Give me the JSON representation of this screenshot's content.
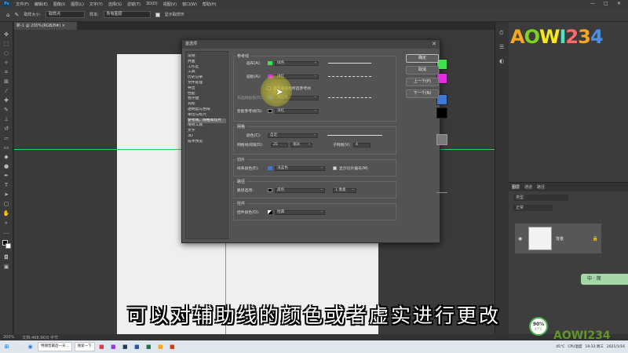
{
  "menubar": {
    "app_icon": "Ps",
    "items": [
      "文件(F)",
      "编辑(E)",
      "图像(I)",
      "图层(L)",
      "文字(Y)",
      "选择(S)",
      "滤镜(T)",
      "3D(D)",
      "视图(V)",
      "窗口(W)",
      "帮助(H)"
    ],
    "window_controls": [
      "—",
      "□",
      "✕"
    ]
  },
  "optionsbar": {
    "sample_size_label": "取样大小:",
    "sample_size_value": "取样点",
    "sample_label": "样本:",
    "sample_value": "所有图层",
    "show_ring_label": "显示取样环"
  },
  "document_tab": {
    "title": "新-1 @ 200%(RGB/8#) ×"
  },
  "dialog": {
    "title": "首选项",
    "close": "✕",
    "categories": [
      "常规",
      "界面",
      "工作区",
      "工具",
      "历史记录",
      "文件处理",
      "导出",
      "性能",
      "暂存盘",
      "光标",
      "透明度与色域",
      "单位与标尺",
      "参考线、网格和切片",
      "增效工具",
      "文字",
      "3D",
      "技术预览"
    ],
    "selected_index": 12,
    "guides": {
      "section_title": "参考线",
      "canvas_label": "画布(A):",
      "canvas_color": "绿色",
      "artboard_label": "画板(A):",
      "artboard_color": "洋红",
      "show_nonselected_label": "显示非画板所选参考线",
      "nonselected_label": "非选择画板(D):",
      "nonselected_color": "浅蓝色",
      "smart_label": "智能参考线(S):",
      "smart_color": "洋红"
    },
    "grid": {
      "section_title": "网格",
      "color_label": "颜色(C):",
      "color_value": "自定",
      "gridline_label": "网格线间隔(D):",
      "gridline_value": "25",
      "unit_value": "毫米",
      "subdiv_label": "子网格(V):",
      "subdiv_value": "4"
    },
    "slices": {
      "section_title": "切片",
      "line_color_label": "线条颜色(E):",
      "line_color": "浅蓝色",
      "show_numbers_label": "显示切片编号(M)"
    },
    "path": {
      "section_title": "路径",
      "options_label": "路径选项:",
      "color_value": "黑色",
      "width_value": "1 像素"
    },
    "controls": {
      "section_title": "控件",
      "color_label": "控件颜色(O):",
      "color_value": "经典"
    },
    "buttons": {
      "ok": "确定",
      "cancel": "取消",
      "prev": "上一个(P)",
      "next": "下一个(N)"
    }
  },
  "colors": {
    "guide_green": "#3ee14f",
    "magenta": "#e32de3",
    "light_blue": "#3d78d9",
    "black": "#000000",
    "grid_gray": "#7a7a7a"
  },
  "layers": {
    "tabs": [
      "图层",
      "通道",
      "路径"
    ],
    "kind_label": "类型",
    "mode_label": "正常",
    "layer_name": "背景"
  },
  "statusbar": {
    "zoom": "200%",
    "doc_info": "文档:468.9K/0 字节"
  },
  "subtitle": "可以对辅助线的颜色或者虚实进行更改",
  "watermark": "AOWI234",
  "badge": {
    "percent": "90%",
    "sub": "47°C"
  },
  "ime": {
    "text": "中 · 简"
  },
  "taskbar": {
    "tasks": [
      "特朗普最后一天...",
      "搜索一下"
    ],
    "tray_temp": "45°C",
    "tray_cpu": "CPU温度",
    "time": "19:33 周三",
    "date": "2021/1/16"
  }
}
